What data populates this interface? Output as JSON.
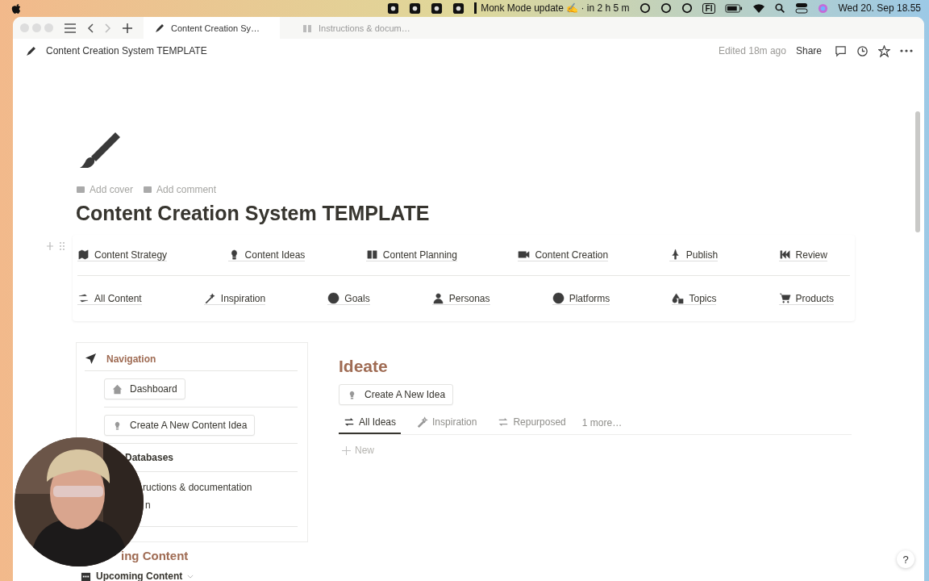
{
  "menubar": {
    "status": "Monk Mode update ✍ · in 2 h 5 m",
    "input_source": "FI",
    "clock": "Wed 20. Sep 18.55"
  },
  "tabs": [
    {
      "label": "Content Creation Sy…",
      "selected": true
    },
    {
      "label": "Instructions & docum…",
      "selected": false
    }
  ],
  "topbar": {
    "breadcrumb": "Content Creation System TEMPLATE",
    "edited": "Edited 18m ago",
    "share": "Share"
  },
  "page": {
    "actions": [
      "Add cover",
      "Add comment"
    ],
    "title": "Content Creation System TEMPLATE"
  },
  "link_rows": [
    {
      "items": [
        "Content Strategy",
        "Content Ideas",
        "Content Planning",
        "Content Creation",
        "Publish",
        "Review"
      ]
    },
    {
      "items": [
        "All Content",
        "Inspiration",
        "Goals",
        "Personas",
        "Platforms",
        "Topics",
        "Products"
      ]
    }
  ],
  "navigation": {
    "title": "Navigation",
    "items": [
      {
        "kind": "button",
        "label": "Dashboard"
      },
      {
        "kind": "button",
        "label": "Create A New Content Idea"
      },
      {
        "kind": "link",
        "label": "Databases"
      },
      {
        "kind": "link",
        "label": "ructions & documentation"
      },
      {
        "kind": "link",
        "label": "n"
      }
    ]
  },
  "upcoming": {
    "heading": "ing Content",
    "view": "Upcoming Content"
  },
  "ideate": {
    "heading": "Ideate",
    "button": "Create A New Idea",
    "views": [
      {
        "label": "All Ideas",
        "selected": true
      },
      {
        "label": "Inspiration",
        "selected": false
      },
      {
        "label": "Repurposed",
        "selected": false
      }
    ],
    "more": "1 more…",
    "new": "New"
  },
  "help": "?"
}
